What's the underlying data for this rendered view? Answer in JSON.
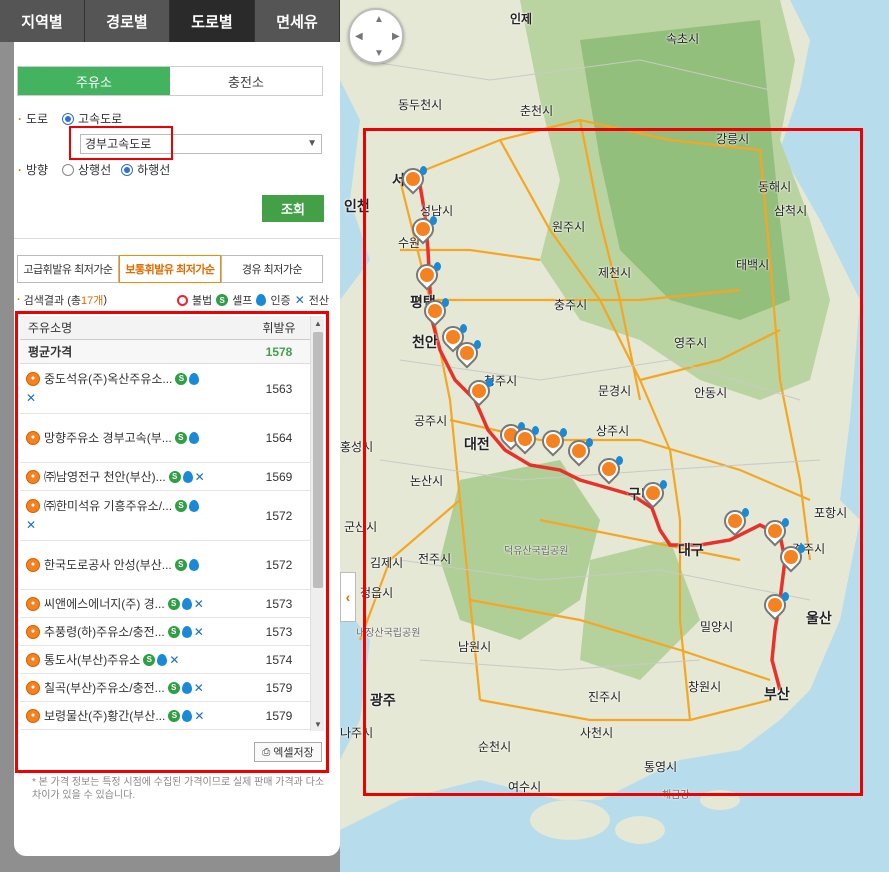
{
  "top_tabs": [
    "지역별",
    "경로별",
    "도로별",
    "면세유"
  ],
  "fuel_tabs": [
    "주유소",
    "충전소"
  ],
  "road": {
    "label": "도로",
    "radio_label": "고속도로",
    "selected": "경부고속도로"
  },
  "direction": {
    "label": "방향",
    "options": [
      "상행선",
      "하행선"
    ],
    "selected": "하행선"
  },
  "search_button": "조회",
  "price_tabs": [
    "고급휘발유 최저가순",
    "보통휘발유 최저가순",
    "경유 최저가순"
  ],
  "result": {
    "prefix": "검색결과 (총 ",
    "count": "17개",
    "suffix": ")"
  },
  "legend": {
    "illegal": "불법",
    "self": "셀프",
    "certified": "인증",
    "card": "전산"
  },
  "list": {
    "col_name": "주유소명",
    "col_price": "휘발유",
    "avg_label": "평균가격",
    "avg_price": "1578",
    "rows": [
      {
        "name": "중도석유(주)옥산주유소...",
        "price": "1563"
      },
      {
        "name": "망향주유소 경부고속(부...",
        "price": "1564"
      },
      {
        "name": "㈜남영전구 천안(부산)...",
        "price": "1569"
      },
      {
        "name": "㈜한미석유 기흥주유소/...",
        "price": "1572"
      },
      {
        "name": "한국도로공사 안성(부산...",
        "price": "1572"
      },
      {
        "name": "씨앤에스에너지(주) 경...",
        "price": "1573"
      },
      {
        "name": "추풍령(하)주유소/충전...",
        "price": "1573"
      },
      {
        "name": "통도사(부산)주유소",
        "price": "1574"
      },
      {
        "name": "칠곡(부산)주유소/충전...",
        "price": "1579"
      },
      {
        "name": "보령물산(주)황간(부산...",
        "price": "1579"
      }
    ]
  },
  "excel_button": "엑셀저장",
  "note": "* 본 가격 정보는 특정 시점에 수집된 가격이므로 실제 판매 가격과 다소 차이가 있을 수 있습니다.",
  "map": {
    "labels": [
      "인제",
      "속초시",
      "동두천시",
      "춘천시",
      "강릉시",
      "서울",
      "동해시",
      "인천",
      "성남시",
      "수원",
      "원주시",
      "삼척시",
      "태백시",
      "제천시",
      "평택",
      "충주시",
      "천안",
      "영주시",
      "청주시",
      "문경시",
      "공주시",
      "안동시",
      "대전",
      "상주시",
      "홍성시",
      "논산시",
      "구미",
      "포항시",
      "군산시",
      "덕유산국립공원",
      "대구",
      "경주시",
      "김제시",
      "전주시",
      "정읍시",
      "울산",
      "내장산국립공원",
      "밀양시",
      "남원시",
      "창원시",
      "부산",
      "광주",
      "진주시",
      "나주시",
      "순천시",
      "사천시",
      "통영시",
      "여수시",
      "해금강"
    ]
  }
}
